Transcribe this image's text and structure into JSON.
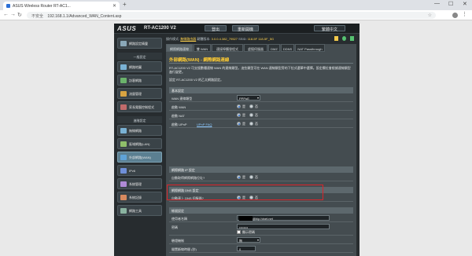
{
  "browser": {
    "tab_title": "ASUS Wireless Router RT-AC1...",
    "address": "192.168.1.1/Advanced_WAN_Content.asp",
    "security_label": "不安全"
  },
  "router": {
    "brand": "ASUS",
    "model": "RT-AC1200 V2",
    "top_buttons": [
      "登出",
      "重新開機"
    ],
    "language": "繁體中文",
    "info": {
      "mode_label": "操作模式:",
      "mode_value": "無線路由器",
      "firmware_label": "韌體版本:",
      "firmware_value": "3.0.0.4.382_79527",
      "ssid_label": "SSID:",
      "ssid_values": [
        "118-5F",
        "118-5F_5G"
      ]
    }
  },
  "sidebar": {
    "top": [
      {
        "label": "網路設定精靈",
        "color": "#8aa8b8"
      }
    ],
    "general_heading": "一般設定",
    "general": [
      {
        "label": "網路地圖",
        "color": "#7ab2d4"
      },
      {
        "label": "訪客網路",
        "color": "#6bb36b"
      },
      {
        "label": "流量管理",
        "color": "#d9a441"
      },
      {
        "label": "家長電腦控制程式",
        "color": "#c26b6b"
      }
    ],
    "advanced_heading": "進階設定",
    "advanced": [
      {
        "label": "無線網路",
        "color": "#7ab2d4"
      },
      {
        "label": "區域網路(LAN)",
        "color": "#8fbf6a"
      },
      {
        "label": "外部網路(WAN)",
        "color": "#5fa3d8",
        "active": true
      },
      {
        "label": "IPv6",
        "color": "#6f8fd8"
      },
      {
        "label": "系統管理",
        "color": "#b08ad6"
      },
      {
        "label": "系統記錄",
        "color": "#d88a5f"
      },
      {
        "label": "網路工具",
        "color": "#8ab3a0"
      }
    ]
  },
  "tabs": [
    "網際網路連線",
    "雙 WAN",
    "連接埠觸發程式",
    "虛擬伺服器",
    "DMZ",
    "DDNS",
    "NAT Passthrough"
  ],
  "content": {
    "title": "外部網路(WAN) - 網際網路連線",
    "desc1": "RT-AC1200 V2 可支援數種連線 WAN 的連線類型。這些類型可在 WAN 連線類型旁的下拉式選單中選擇。設定欄位會根據連線類型進行變更。",
    "desc2": "設定 RT-AC1200 V2 的乙太網路設定。",
    "basic_heading": "基本設定",
    "wan_type_label": "WAN 連線類型",
    "wan_type_value": "PPPoE",
    "enable_wan_label": "啟動 WAN",
    "enable_nat_label": "啟動 NAT",
    "enable_upnp_label": "啟動 UPnP",
    "upnp_link": "UPnP FAQ",
    "yes": "是",
    "no": "否",
    "ip_heading": "網際網路 IP 設定",
    "auto_ip_label": "自動取得網際網路位址?",
    "dns_heading": "網際網路 DNS 設定",
    "auto_dns_label": "自動連上 DNS 伺服器?",
    "account_heading": "帳號設定",
    "username_label": "使用者名稱",
    "username_value": "@hip.hinet.net",
    "password_label": "密碼",
    "password_value": "••••••••",
    "show_password": "顯示密碼",
    "auth_label": "驗證機制",
    "auth_value": "無",
    "idle_label": "閒置斷線時間 (秒)",
    "idle_value": "0",
    "mtu_label": "最大傳輸單位 (MTU)",
    "mtu_value": "1492",
    "mru_label": "最大接收單位 (MRU)",
    "mru_value": "1492",
    "service_label": "網路服務名稱"
  }
}
